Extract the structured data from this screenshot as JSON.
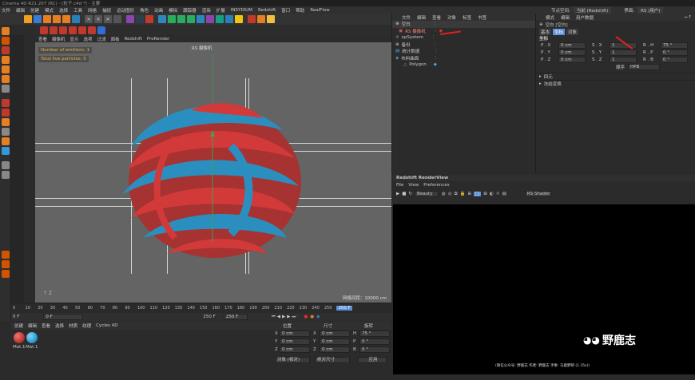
{
  "window": {
    "title": "Cinema 4D R21.207 (RC) - [粒子.c4d *] - 主要"
  },
  "main_menu": [
    "文件",
    "编辑",
    "创建",
    "模式",
    "选择",
    "工具",
    "网格",
    "捕捉",
    "运动图形",
    "角色",
    "动画",
    "模拟",
    "跟踪器",
    "渲染",
    "扩展",
    "INSYDIUM",
    "Redshift",
    "窗口",
    "帮助",
    "RealFlow"
  ],
  "right_menu": {
    "node_space_label": "节点空间:",
    "node_space_value": "当前 (Redshift)",
    "interface_label": "界面:",
    "interface_value": "RS (用户)"
  },
  "viewport": {
    "menu": [
      "查看",
      "摄像机",
      "显示",
      "选项",
      "过滤",
      "面板",
      "Redshift",
      "ProRender"
    ],
    "camera_label": "RS 摄像机",
    "hud_emitters": "Number of emitters: 1",
    "hud_particles": "Total live particles: 0",
    "grid_spacing": "网格间距：10000 cm"
  },
  "timeline": {
    "ticks": [
      "0",
      "10",
      "20",
      "30",
      "40",
      "50",
      "60",
      "70",
      "80",
      "90",
      "100",
      "110",
      "120",
      "130",
      "140",
      "150",
      "160",
      "170",
      "180",
      "190",
      "200",
      "210",
      "220",
      "230",
      "240",
      "250"
    ],
    "current_frame": "0 F",
    "start_frame": "0 F",
    "end_frame": "250 F",
    "end_frame2": "250 F",
    "frame_marker": "250 F"
  },
  "material_manager": {
    "menu": [
      "创建",
      "编辑",
      "查看",
      "选择",
      "材质",
      "纹理",
      "Cycles 4D"
    ],
    "materials": [
      {
        "name": "Mat.1",
        "color": "#c0392b"
      },
      {
        "name": "Mat.1",
        "color": "#2a9fd6"
      }
    ]
  },
  "coordinates": {
    "headers": [
      "位置",
      "尺寸",
      "旋转"
    ],
    "rows": [
      {
        "axis": "X",
        "pos": "0 cm",
        "size_axis": "X",
        "size": "0 cm",
        "rot_axis": "H",
        "rot": "75 °"
      },
      {
        "axis": "Y",
        "pos": "0 cm",
        "size_axis": "Y",
        "size": "0 cm",
        "rot_axis": "P",
        "rot": "0 °"
      },
      {
        "axis": "Z",
        "pos": "0 cm",
        "size_axis": "Z",
        "size": "0 cm",
        "rot_axis": "B",
        "rot": "0 °"
      }
    ],
    "mode_object": "对象 (相对)",
    "mode_size": "绝对尺寸",
    "apply_button": "应用"
  },
  "object_manager": {
    "menu": [
      "文件",
      "编辑",
      "查看",
      "对象",
      "标签",
      "书签"
    ],
    "objects": [
      "空白",
      "RS 摄像机",
      "xpSystem",
      "备份",
      "统计数据",
      "布料曲面",
      "Polygon"
    ]
  },
  "attributes": {
    "menu": [
      "模式",
      "编辑",
      "用户数据"
    ],
    "object_label": "空白 [空白]",
    "tabs": [
      "基本",
      "坐标",
      "对象"
    ],
    "section": "坐标",
    "rows": [
      {
        "p": "P . X",
        "pv": "0 cm",
        "s": "S . X",
        "sv": "1",
        "r": "R . H",
        "rv": "75 °"
      },
      {
        "p": "P . Y",
        "pv": "0 cm",
        "s": "S . Y",
        "sv": "1",
        "r": "R . P",
        "rv": "0 °"
      },
      {
        "p": "P . Z",
        "pv": "0 cm",
        "s": "S . Z",
        "sv": "1",
        "r": "R . B",
        "rv": "0 °"
      }
    ],
    "order_label": "顺序",
    "order_value": "HPB",
    "collapsed_1": "四元",
    "collapsed_2": "冻结变换"
  },
  "redshift_view": {
    "title": "Redshift RenderView",
    "menu": [
      "File",
      "View",
      "Preferences"
    ],
    "beauty": "Beauty",
    "rs_shader": "RS Shader",
    "footer": "(微信公众号: 野鹿志    作者: 野鹿志    手象: 马鹿野郎   (1.35s))"
  },
  "watermark": {
    "text": "野鹿志"
  },
  "colors": {
    "accent_red": "#e02020",
    "mesh_red": "#d23a3a",
    "mesh_blue": "#2a8fbf",
    "hud_yellow": "#e3b24a"
  }
}
